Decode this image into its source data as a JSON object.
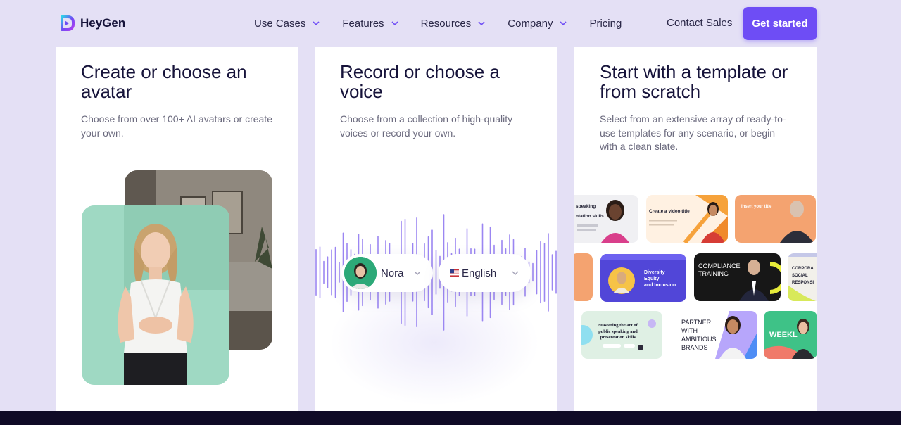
{
  "brand": {
    "name": "HeyGen",
    "accent": "#6e4df5"
  },
  "nav": {
    "items": [
      {
        "label": "Use Cases",
        "has_dropdown": true
      },
      {
        "label": "Features",
        "has_dropdown": true
      },
      {
        "label": "Resources",
        "has_dropdown": true
      },
      {
        "label": "Company",
        "has_dropdown": true
      },
      {
        "label": "Pricing",
        "has_dropdown": false
      }
    ],
    "contact_label": "Contact Sales",
    "cta_label": "Get started"
  },
  "cards": [
    {
      "title": "Create or choose an avatar",
      "description": "Choose from over 100+ AI avatars or create your own."
    },
    {
      "title": "Record or choose a voice",
      "description": "Choose from a collection of high-quality voices or record your own.",
      "voice_selector": {
        "voice": "Nora",
        "language": "English"
      }
    },
    {
      "title": "Start with a template or from scratch",
      "description": "Select from an extensive array of ready-to-use templates for any scenario, or begin with a clean slate.",
      "templates": [
        {
          "title": "speaking\nntation skills"
        },
        {
          "title": "Create a video title"
        },
        {
          "title": "Insert your title"
        },
        {
          "title": "Diversity\nEquity\nand Inclusion"
        },
        {
          "title": "COMPLIANCE\nTRAINING"
        },
        {
          "title": "CORPORA\nSOCIAL\nRESPONSI"
        },
        {
          "title": "Mastering the art of\npublic speaking and\npresentation skills"
        },
        {
          "title": "PARTNER\nWITH\nAMBITIOUS\nBRANDS"
        },
        {
          "title": "WEEKL"
        }
      ]
    }
  ]
}
